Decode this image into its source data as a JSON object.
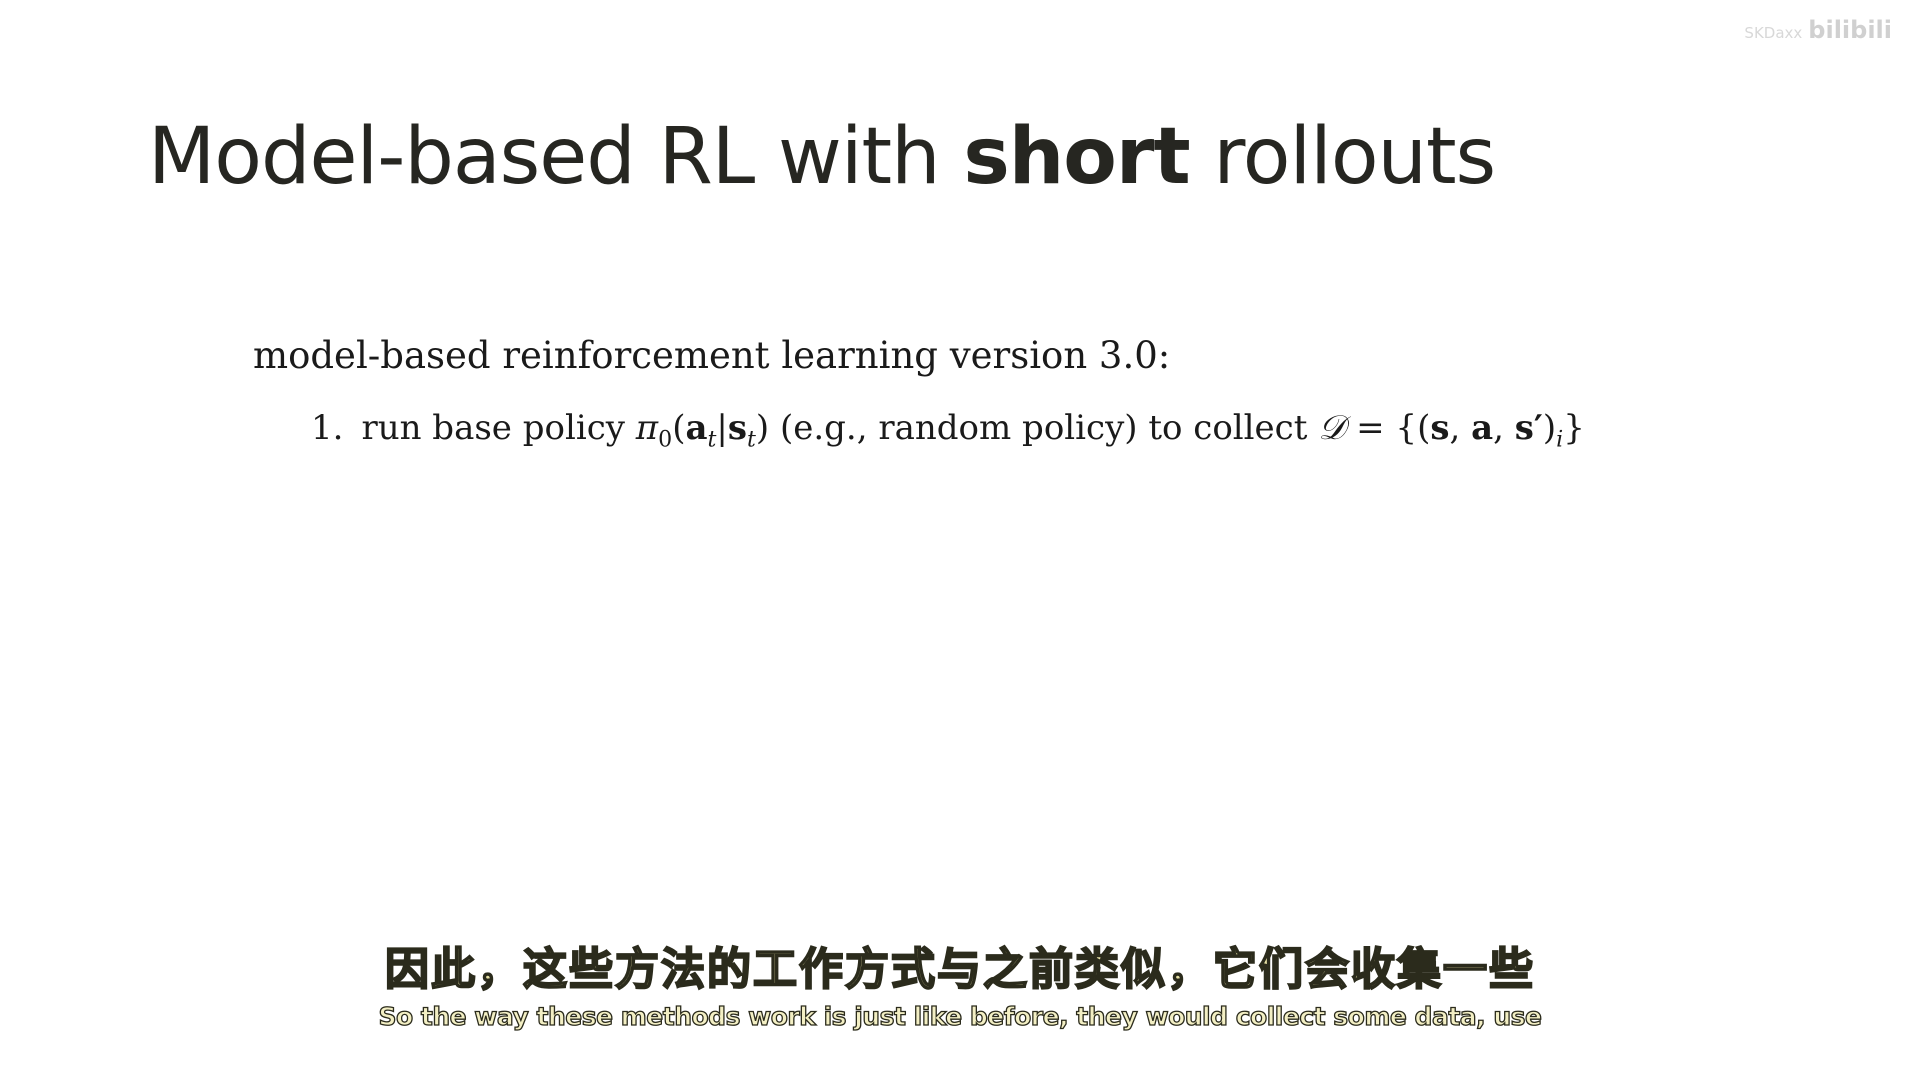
{
  "slide": {
    "title_prefix": "Model-based RL with ",
    "title_emphasis": "short",
    "title_suffix": " rollouts",
    "algorithm_heading": "model-based reinforcement learning version 3.0:",
    "steps": [
      {
        "number": "1.",
        "text_before_math": "run base policy ",
        "policy": "π",
        "policy_sub": "0",
        "policy_open": "(",
        "policy_a": "a",
        "policy_a_sub": "t",
        "policy_bar": "|",
        "policy_s": "s",
        "policy_s_sub": "t",
        "policy_close": ")",
        "text_middle": " (e.g., random policy) to collect ",
        "dataset_symbol": "𝒟",
        "dataset_eq": " = {(",
        "dataset_s": "s",
        "dataset_comma1": ", ",
        "dataset_a": "a",
        "dataset_comma2": ", ",
        "dataset_sprime": "s′",
        "dataset_close": ")",
        "dataset_sub": "i",
        "dataset_end": "}"
      }
    ]
  },
  "subtitles": {
    "chinese": "因此，这些方法的工作方式与之前类似，它们会收集一些",
    "english": "So the way these methods work is just like before, they would collect some data, use"
  },
  "watermark": {
    "text": "SKDaxx",
    "logo": "bilibili"
  }
}
